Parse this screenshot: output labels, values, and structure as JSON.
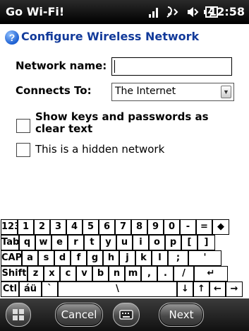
{
  "status_bar": {
    "carrier": "Go Wi-Fi!",
    "time": "12:58",
    "icons": [
      "signal-icon",
      "roaming-data-icon",
      "speaker-icon",
      "battery-charging-icon"
    ]
  },
  "header": {
    "title": "Configure Wireless Network",
    "icon": "help-icon"
  },
  "form": {
    "network_name_label": "Network name:",
    "network_name_value": "",
    "connects_to_label": "Connects To:",
    "connects_to_value": "The Internet",
    "show_keys_label": "Show keys and passwords as clear text",
    "show_keys_checked": false,
    "hidden_network_label": "This is a hidden network",
    "hidden_network_checked": false
  },
  "keyboard": {
    "row1": [
      "123",
      "1",
      "2",
      "3",
      "4",
      "5",
      "6",
      "7",
      "8",
      "9",
      "0",
      "-",
      "=",
      "◆"
    ],
    "row2": [
      "Tab",
      "q",
      "w",
      "e",
      "r",
      "t",
      "y",
      "u",
      "i",
      "o",
      "p",
      "[",
      "]"
    ],
    "row3": [
      "CAP",
      "a",
      "s",
      "d",
      "f",
      "g",
      "h",
      "j",
      "k",
      "l",
      ";",
      "'"
    ],
    "row4": [
      "Shift",
      "z",
      "x",
      "c",
      "v",
      "b",
      "n",
      "m",
      ",",
      ".",
      "/",
      "↵"
    ],
    "row5": [
      "Ctl",
      "áü",
      "`",
      "\\",
      "↓",
      "↑",
      "←",
      "→"
    ]
  },
  "soft_bar": {
    "start_icon": "windows-start-icon",
    "left_label": "Cancel",
    "keyboard_icon": "keyboard-icon",
    "right_label": "Next"
  }
}
